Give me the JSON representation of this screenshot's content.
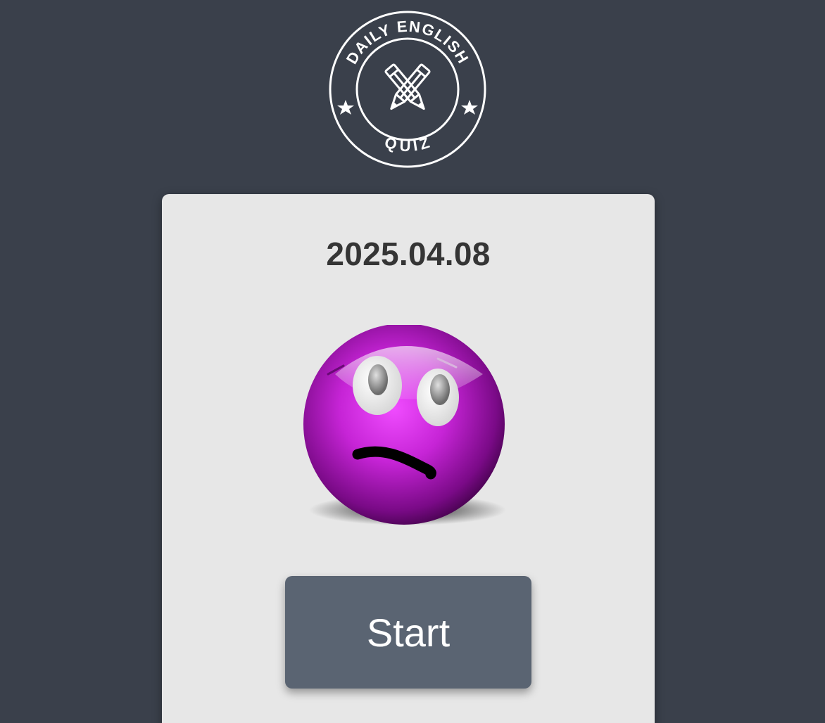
{
  "logo": {
    "top_text": "DAILY ENGLISH",
    "bottom_text": "QUIZ",
    "icon": "crossed-pencils-icon"
  },
  "quiz": {
    "date": "2025.04.08",
    "mascot": "confused-purple-smiley",
    "start_label": "Start"
  },
  "colors": {
    "background": "#3a404b",
    "card": "#e7e7e7",
    "button": "#5a6472",
    "text": "#353535",
    "mascot": "#b81fc9"
  }
}
